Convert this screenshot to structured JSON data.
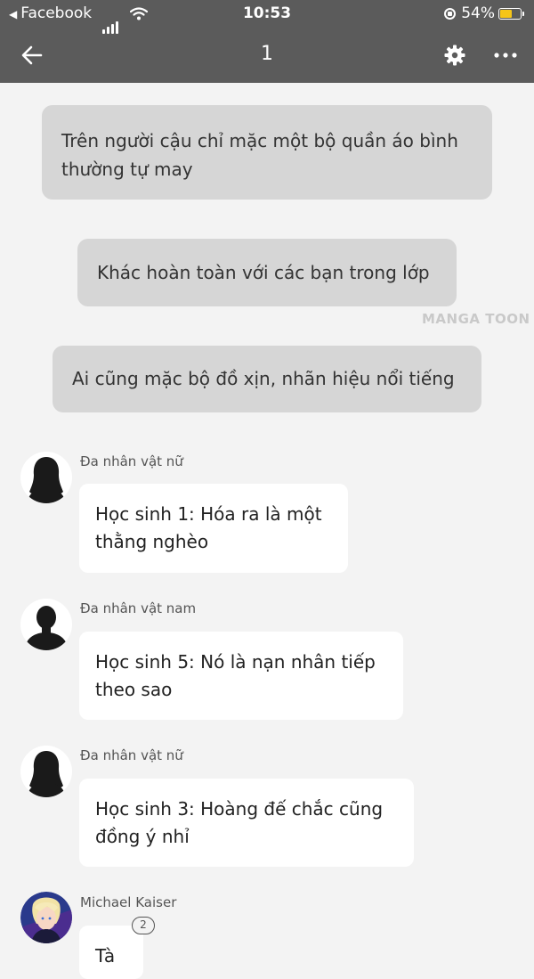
{
  "status_bar": {
    "back_app": "Facebook",
    "time": "10:53",
    "battery": "54%"
  },
  "header": {
    "title": "1",
    "icons": [
      "back-arrow-icon",
      "gear-icon",
      "more-icon"
    ]
  },
  "narration": [
    "Trên người cậu chỉ mặc một bộ quần áo bình thường tự may",
    "Khác hoàn toàn với các bạn trong lớp",
    "Ai cũng mặc bộ đồ xịn, nhãn hiệu nổi tiếng"
  ],
  "watermark": "MANGA TOON",
  "messages": [
    {
      "name": "Đa nhân vật nữ",
      "text": "Học sinh 1: Hóa ra là một thằng nghèo",
      "avatar": "female-silhouette"
    },
    {
      "name": "Đa nhân vật nam",
      "text": "Học sinh 5: Nó là nạn nhân tiếp theo sao",
      "avatar": "male-silhouette"
    },
    {
      "name": "Đa nhân vật nữ",
      "text": "Học sinh 3: Hoàng đế chắc cũng đồng ý nhỉ",
      "avatar": "female-silhouette"
    },
    {
      "name": "Michael Kaiser",
      "text": "Tà",
      "avatar": "character-portrait",
      "comment_count": "2"
    }
  ],
  "colors": {
    "header_bg": "#5b5b5b",
    "page_bg": "#f3f3f3",
    "narration_bg": "#d6d6d6",
    "bubble_bg": "#ffffff"
  }
}
